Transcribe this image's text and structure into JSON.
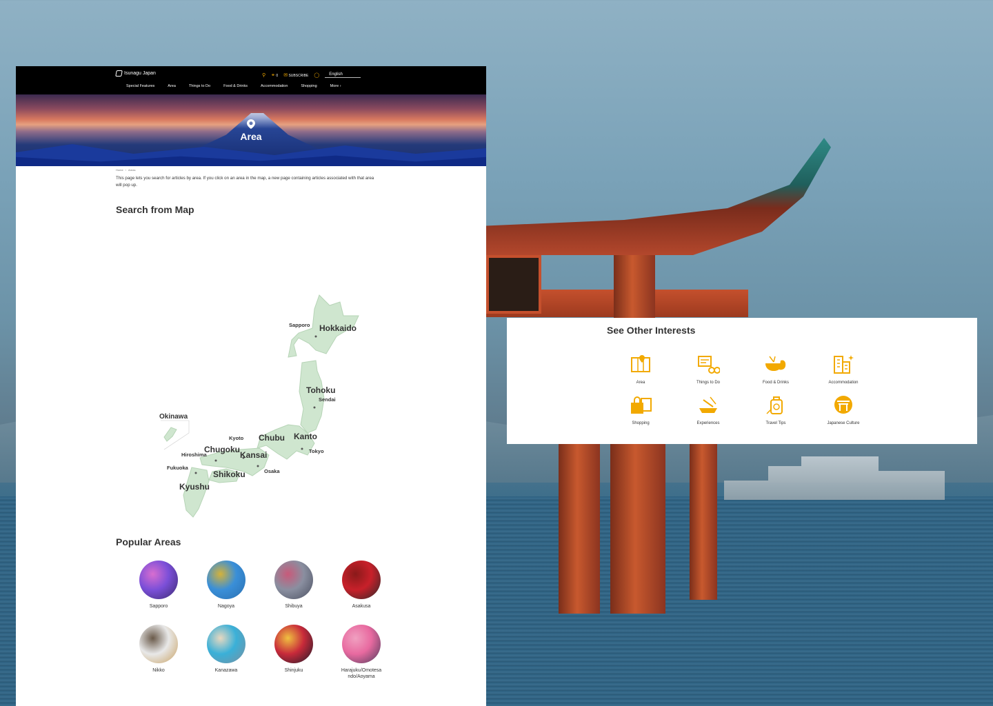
{
  "site": {
    "brand": "Isunagu Japan",
    "util": {
      "cart_count": "0",
      "subscribe": "SUBSCRIBE",
      "language": "English"
    },
    "nav": [
      "Special Features",
      "Area",
      "Things to Do",
      "Food & Drinks",
      "Accommodation",
      "Shopping",
      "More"
    ],
    "hero_title": "Area",
    "breadcrumb": [
      "Home",
      "Areas"
    ],
    "intro": "This page lets you search for articles by area. If you click on an area in the map, a new page containing articles associated with that area will pop up.",
    "map_section_title": "Search from Map",
    "map": {
      "regions": [
        "Hokkaido",
        "Tohoku",
        "Chubu",
        "Kanto",
        "Kansai",
        "Chugoku",
        "Shikoku",
        "Kyushu",
        "Okinawa"
      ],
      "cities": [
        "Sapporo",
        "Sendai",
        "Kyoto",
        "Tokyo",
        "Hiroshima",
        "Osaka",
        "Fukuoka"
      ]
    },
    "popular_title": "Popular Areas",
    "popular_areas": [
      {
        "name": "Sapporo",
        "colors": [
          "#7b4fd8",
          "#d86ed0",
          "#3a2a6e"
        ]
      },
      {
        "name": "Nagoya",
        "colors": [
          "#3a8fd8",
          "#d4b23a",
          "#2a6fb0"
        ]
      },
      {
        "name": "Shibuya",
        "colors": [
          "#8a8fa0",
          "#c85a7a",
          "#4a4f60"
        ]
      },
      {
        "name": "Asakusa",
        "colors": [
          "#c8202a",
          "#8a1a1a",
          "#2a2a2a"
        ]
      },
      {
        "name": "Nikko",
        "colors": [
          "#e8e8e8",
          "#6a5a4a",
          "#c8a060"
        ]
      },
      {
        "name": "Kanazawa",
        "colors": [
          "#3ab0d8",
          "#e8d8c0",
          "#7a8fa0"
        ]
      },
      {
        "name": "Shinjuku",
        "colors": [
          "#c82a3a",
          "#f0c040",
          "#1a1a2a"
        ]
      },
      {
        "name": "Harajuku/Omotesando/Aoyama",
        "colors": [
          "#e86aa0",
          "#f0a0c0",
          "#4a3a5a"
        ]
      }
    ]
  },
  "interests": {
    "title": "See Other Interests",
    "items": [
      {
        "label": "Area",
        "icon": "map-icon"
      },
      {
        "label": "Things to Do",
        "icon": "bike-icon"
      },
      {
        "label": "Food & Drinks",
        "icon": "food-icon"
      },
      {
        "label": "Accommodation",
        "icon": "hotel-icon"
      },
      {
        "label": "Shopping",
        "icon": "shopping-bag-icon"
      },
      {
        "label": "Experiences",
        "icon": "boat-icon"
      },
      {
        "label": "Travel Tips",
        "icon": "suitcase-icon"
      },
      {
        "label": "Japanese Culture",
        "icon": "culture-icon"
      }
    ],
    "accent": "#f2a900"
  }
}
